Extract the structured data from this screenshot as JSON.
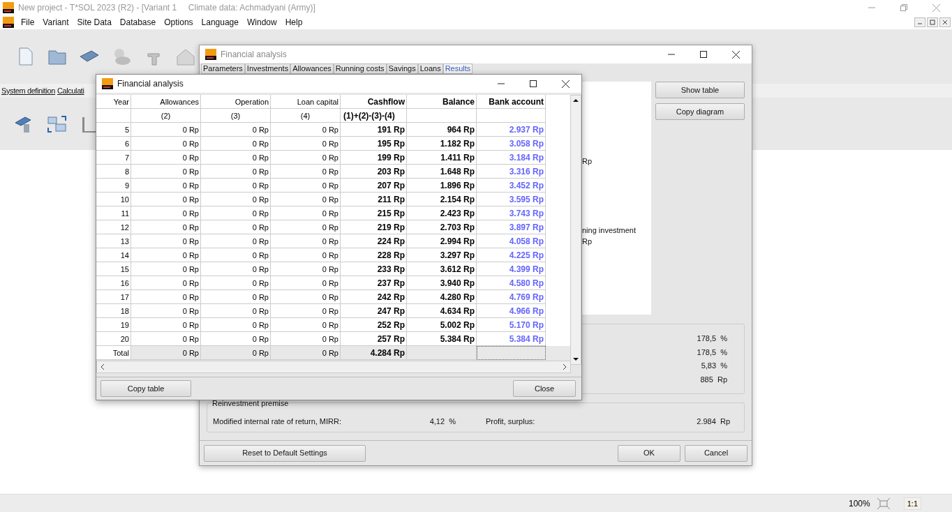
{
  "app": {
    "title": "New project - T*SOL 2023 (R2) - [Variant 1     Climate data: Achmadyani (Army)]",
    "menu": [
      "File",
      "Variant",
      "Site Data",
      "Database",
      "Options",
      "Language",
      "Window",
      "Help"
    ],
    "sections": [
      "System definition",
      "Calculati"
    ]
  },
  "back_window": {
    "title": "Financial analysis",
    "tabs": [
      {
        "label": "Parameters",
        "selected": false
      },
      {
        "label": "Investments",
        "selected": false
      },
      {
        "label": "Allowances",
        "selected": false
      },
      {
        "label": "Running costs",
        "selected": false
      },
      {
        "label": "Savings",
        "selected": false
      },
      {
        "label": "Loans",
        "selected": false
      },
      {
        "label": "Results",
        "selected": true
      }
    ],
    "chart_fragments": [
      "Rp",
      "ning investment",
      "Rp"
    ],
    "side_buttons": [
      "Show table",
      "Copy diagram"
    ],
    "results": [
      {
        "value": "178,5",
        "unit": "%"
      },
      {
        "value": "178,5",
        "unit": "%"
      },
      {
        "value": "5,83",
        "unit": "%"
      },
      {
        "value": "885",
        "unit": "Rp"
      }
    ],
    "reinvestment": {
      "title": "Reinvestment premise",
      "mirr_label": "Modified internal rate of return, MIRR:",
      "mirr_value": "4,12",
      "mirr_unit": "%",
      "profit_label": "Profit, surplus:",
      "profit_value": "2.984",
      "profit_unit": "Rp"
    },
    "reset_button": "Reset to Default Settings",
    "ok_button": "OK",
    "cancel_button": "Cancel"
  },
  "front_window": {
    "title": "Financial analysis",
    "columns": [
      {
        "label": "Year",
        "bold": false
      },
      {
        "label": "Allowances",
        "sub": "(2)",
        "bold": false
      },
      {
        "label": "Operation",
        "sub": "(3)",
        "bold": false
      },
      {
        "label": "Loan capital",
        "sub": "(4)",
        "bold": false
      },
      {
        "label": "Cashflow",
        "sub": "(1)+(2)-(3)-(4)",
        "bold": true
      },
      {
        "label": "Balance",
        "bold": true
      },
      {
        "label": "Bank account",
        "bold": true
      }
    ],
    "rows": [
      [
        "5",
        "0 Rp",
        "0 Rp",
        "0 Rp",
        "191 Rp",
        "964 Rp",
        "2.937 Rp"
      ],
      [
        "6",
        "0 Rp",
        "0 Rp",
        "0 Rp",
        "195 Rp",
        "1.182 Rp",
        "3.058 Rp"
      ],
      [
        "7",
        "0 Rp",
        "0 Rp",
        "0 Rp",
        "199 Rp",
        "1.411 Rp",
        "3.184 Rp"
      ],
      [
        "8",
        "0 Rp",
        "0 Rp",
        "0 Rp",
        "203 Rp",
        "1.648 Rp",
        "3.316 Rp"
      ],
      [
        "9",
        "0 Rp",
        "0 Rp",
        "0 Rp",
        "207 Rp",
        "1.896 Rp",
        "3.452 Rp"
      ],
      [
        "10",
        "0 Rp",
        "0 Rp",
        "0 Rp",
        "211 Rp",
        "2.154 Rp",
        "3.595 Rp"
      ],
      [
        "11",
        "0 Rp",
        "0 Rp",
        "0 Rp",
        "215 Rp",
        "2.423 Rp",
        "3.743 Rp"
      ],
      [
        "12",
        "0 Rp",
        "0 Rp",
        "0 Rp",
        "219 Rp",
        "2.703 Rp",
        "3.897 Rp"
      ],
      [
        "13",
        "0 Rp",
        "0 Rp",
        "0 Rp",
        "224 Rp",
        "2.994 Rp",
        "4.058 Rp"
      ],
      [
        "14",
        "0 Rp",
        "0 Rp",
        "0 Rp",
        "228 Rp",
        "3.297 Rp",
        "4.225 Rp"
      ],
      [
        "15",
        "0 Rp",
        "0 Rp",
        "0 Rp",
        "233 Rp",
        "3.612 Rp",
        "4.399 Rp"
      ],
      [
        "16",
        "0 Rp",
        "0 Rp",
        "0 Rp",
        "237 Rp",
        "3.940 Rp",
        "4.580 Rp"
      ],
      [
        "17",
        "0 Rp",
        "0 Rp",
        "0 Rp",
        "242 Rp",
        "4.280 Rp",
        "4.769 Rp"
      ],
      [
        "18",
        "0 Rp",
        "0 Rp",
        "0 Rp",
        "247 Rp",
        "4.634 Rp",
        "4.966 Rp"
      ],
      [
        "19",
        "0 Rp",
        "0 Rp",
        "0 Rp",
        "252 Rp",
        "5.002 Rp",
        "5.170 Rp"
      ],
      [
        "20",
        "0 Rp",
        "0 Rp",
        "0 Rp",
        "257 Rp",
        "5.384 Rp",
        "5.384 Rp"
      ]
    ],
    "total": [
      "Total",
      "0 Rp",
      "0 Rp",
      "0 Rp",
      "4.284 Rp"
    ],
    "copy_button": "Copy table",
    "close_button": "Close"
  },
  "status_bar": {
    "zoom": "100%",
    "one_to_one": "1:1"
  }
}
